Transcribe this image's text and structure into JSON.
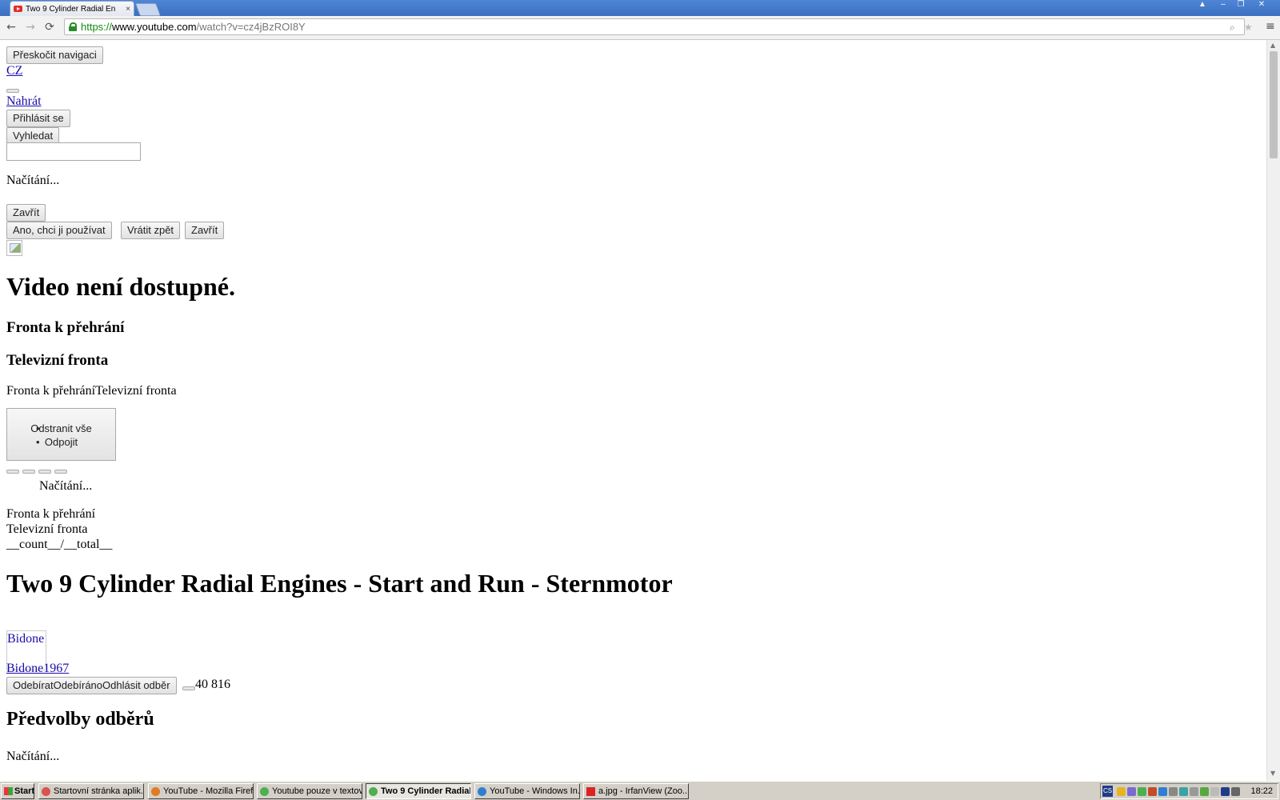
{
  "browser": {
    "tab_title": "Two 9 Cylinder Radial En",
    "tab_close": "×",
    "url_scheme": "https://",
    "url_host": "www.youtube.com",
    "url_path": "/watch?v=cz4jBzROI8Y",
    "back": "←",
    "forward": "→",
    "reload": "⟳",
    "menu": "≡",
    "zoom_icon": "⌕",
    "star_icon": "★",
    "window_controls": [
      "▲",
      "–",
      "❐",
      "✕"
    ]
  },
  "page": {
    "skip_nav": "Přeskočit navigaci",
    "country": "CZ",
    "upload": "Nahrát",
    "signin": "Přihlásit se",
    "search": "Vyhledat",
    "search_value": "",
    "loading1": "Načítání...",
    "close1": "Zavřít",
    "yes_use": "Ano, chci ji používat",
    "undo": "Vrátit zpět",
    "close2": "Zavřít",
    "unavailable": "Video není dostupné.",
    "queue_heading": "Fronta k přehrání",
    "tvqueue_heading": "Televizní fronta",
    "queue_inline": "Fronta k přehráníTelevizní fronta",
    "menu_items": [
      "Odstranit vše",
      "Odpojit"
    ],
    "loading2": "Načítání...",
    "queue_line": "Fronta k přehrání",
    "tvqueue_line": "Televizní fronta",
    "count_total": "__count__/__total__",
    "video_title": "Two 9 Cylinder Radial Engines - Start and Run - Sternmotor",
    "avatar_alt": "Bidone1967",
    "channel": "Bidone1967",
    "subscribe_btn": "OdebíratOdebíránoOdhlásit odběr",
    "sub_count": "40 816",
    "sub_prefs": "Předvolby odběrů",
    "loading3": "Načítání..."
  },
  "taskbar": {
    "start": "Start",
    "tasks": [
      "Startovní stránka aplik...",
      "YouTube - Mozilla Firef...",
      "Youtube pouze v textov...",
      "Two 9 Cylinder Radial...",
      "YouTube - Windows In...",
      "a.jpg - IrfanView (Zoo..."
    ],
    "tray_lang": "CS",
    "clock": "18:22"
  },
  "colors": {
    "titlebar": "#4f86d6",
    "link": "#1a0dab",
    "https": "#118a11"
  }
}
